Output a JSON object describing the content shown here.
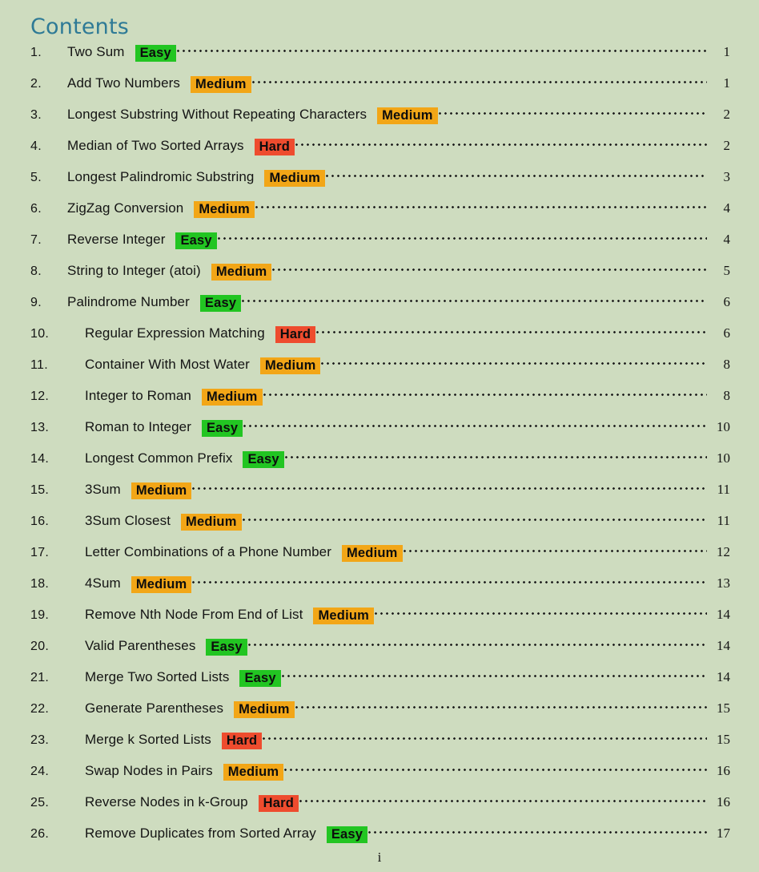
{
  "heading": "Contents",
  "footer": {
    "page_label": "i"
  },
  "colors": {
    "background": "#cedcbf",
    "heading": "#2e7a96",
    "easy": "#22c522",
    "medium": "#f2a617",
    "hard": "#ee4c2e",
    "text": "#141414"
  },
  "difficulty_labels": {
    "easy": "Easy",
    "medium": "Medium",
    "hard": "Hard"
  },
  "toc": {
    "entries": [
      {
        "num": "1.",
        "title": "Two Sum",
        "difficulty": "Easy",
        "level": "easy",
        "page": "1"
      },
      {
        "num": "2.",
        "title": "Add Two Numbers",
        "difficulty": "Medium",
        "level": "medium",
        "page": "1"
      },
      {
        "num": "3.",
        "title": "Longest Substring Without Repeating Characters",
        "difficulty": "Medium",
        "level": "medium",
        "page": "2"
      },
      {
        "num": "4.",
        "title": "Median of Two Sorted Arrays",
        "difficulty": "Hard",
        "level": "hard",
        "page": "2"
      },
      {
        "num": "5.",
        "title": "Longest Palindromic Substring",
        "difficulty": "Medium",
        "level": "medium",
        "page": "3"
      },
      {
        "num": "6.",
        "title": "ZigZag Conversion",
        "difficulty": "Medium",
        "level": "medium",
        "page": "4"
      },
      {
        "num": "7.",
        "title": "Reverse Integer",
        "difficulty": "Easy",
        "level": "easy",
        "page": "4"
      },
      {
        "num": "8.",
        "title": "String to Integer (atoi)",
        "difficulty": "Medium",
        "level": "medium",
        "page": "5"
      },
      {
        "num": "9.",
        "title": "Palindrome Number",
        "difficulty": "Easy",
        "level": "easy",
        "page": "6"
      },
      {
        "num": "10.",
        "title": "Regular Expression Matching",
        "difficulty": "Hard",
        "level": "hard",
        "page": "6"
      },
      {
        "num": "11.",
        "title": "Container With Most Water",
        "difficulty": "Medium",
        "level": "medium",
        "page": "8"
      },
      {
        "num": "12.",
        "title": "Integer to Roman",
        "difficulty": "Medium",
        "level": "medium",
        "page": "8"
      },
      {
        "num": "13.",
        "title": "Roman to Integer",
        "difficulty": "Easy",
        "level": "easy",
        "page": "10"
      },
      {
        "num": "14.",
        "title": "Longest Common Prefix",
        "difficulty": "Easy",
        "level": "easy",
        "page": "10"
      },
      {
        "num": "15.",
        "title": "3Sum",
        "difficulty": "Medium",
        "level": "medium",
        "page": "11"
      },
      {
        "num": "16.",
        "title": "3Sum Closest",
        "difficulty": "Medium",
        "level": "medium",
        "page": "11"
      },
      {
        "num": "17.",
        "title": "Letter Combinations of a Phone Number",
        "difficulty": "Medium",
        "level": "medium",
        "page": "12"
      },
      {
        "num": "18.",
        "title": "4Sum",
        "difficulty": "Medium",
        "level": "medium",
        "page": "13"
      },
      {
        "num": "19.",
        "title": "Remove Nth Node From End of List",
        "difficulty": "Medium",
        "level": "medium",
        "page": "14"
      },
      {
        "num": "20.",
        "title": "Valid Parentheses",
        "difficulty": "Easy",
        "level": "easy",
        "page": "14"
      },
      {
        "num": "21.",
        "title": "Merge Two Sorted Lists",
        "difficulty": "Easy",
        "level": "easy",
        "page": "14"
      },
      {
        "num": "22.",
        "title": "Generate Parentheses",
        "difficulty": "Medium",
        "level": "medium",
        "page": "15"
      },
      {
        "num": "23.",
        "title": "Merge k Sorted Lists",
        "difficulty": "Hard",
        "level": "hard",
        "page": "15"
      },
      {
        "num": "24.",
        "title": "Swap Nodes in Pairs",
        "difficulty": "Medium",
        "level": "medium",
        "page": "16"
      },
      {
        "num": "25.",
        "title": "Reverse Nodes in k-Group",
        "difficulty": "Hard",
        "level": "hard",
        "page": "16"
      },
      {
        "num": "26.",
        "title": "Remove Duplicates from Sorted Array",
        "difficulty": "Easy",
        "level": "easy",
        "page": "17"
      }
    ]
  }
}
